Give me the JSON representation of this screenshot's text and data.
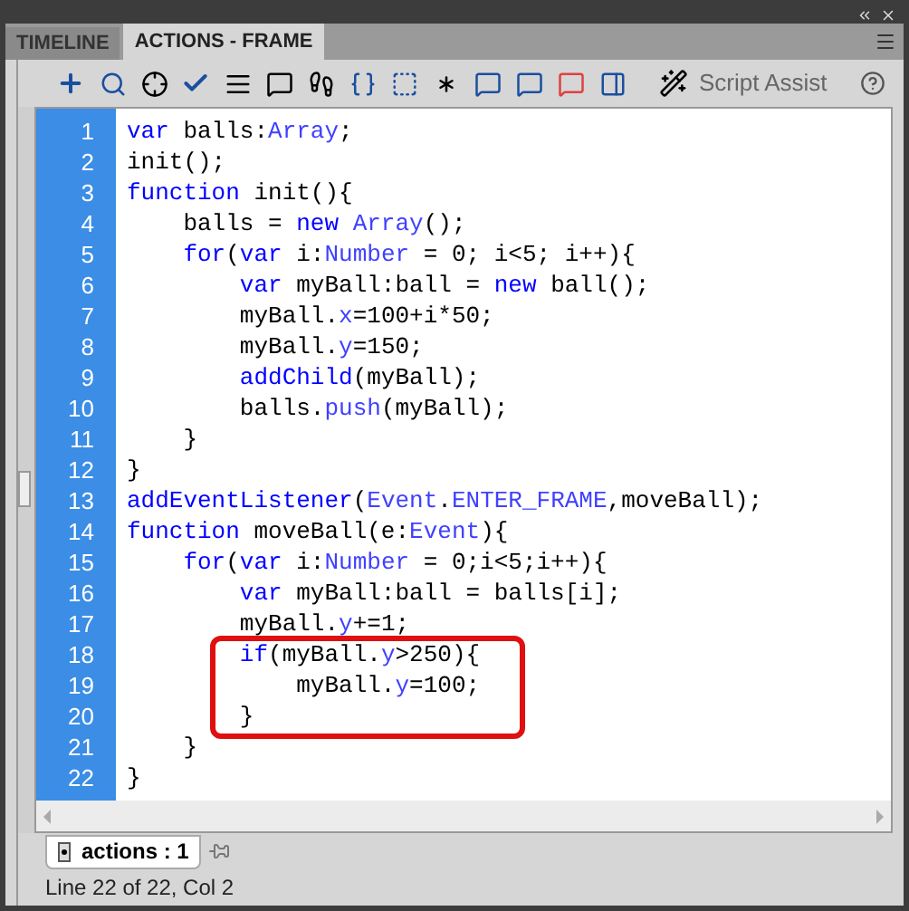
{
  "tabs": [
    {
      "label": "TIMELINE",
      "selected": false
    },
    {
      "label": "ACTIONS - FRAME",
      "selected": true
    }
  ],
  "toolbar": {
    "script_assist": "Script Assist"
  },
  "code": [
    {
      "kind": "line",
      "number": "1",
      "segments": [
        {
          "text": "var",
          "kind": "keyword"
        },
        {
          "text": " balls:",
          "kind": "plain"
        },
        {
          "text": "Array",
          "kind": "type"
        },
        {
          "text": ";",
          "kind": "plain"
        }
      ]
    },
    {
      "kind": "line",
      "number": "2",
      "segments": [
        {
          "text": "init();",
          "kind": "plain"
        }
      ]
    },
    {
      "kind": "line",
      "number": "3",
      "segments": [
        {
          "text": "function",
          "kind": "keyword"
        },
        {
          "text": " init(){",
          "kind": "plain"
        }
      ]
    },
    {
      "kind": "line",
      "number": "4",
      "segments": [
        {
          "text": "    balls = ",
          "kind": "plain"
        },
        {
          "text": "new",
          "kind": "keyword"
        },
        {
          "text": " Array",
          "kind": "type"
        },
        {
          "text": "();",
          "kind": "plain"
        }
      ]
    },
    {
      "kind": "line",
      "number": "5",
      "segments": [
        {
          "text": "    for",
          "kind": "keyword"
        },
        {
          "text": "(",
          "kind": "plain"
        },
        {
          "text": "var",
          "kind": "keyword"
        },
        {
          "text": " i:",
          "kind": "plain"
        },
        {
          "text": "Number",
          "kind": "type"
        },
        {
          "text": " = 0; i<5; i++){",
          "kind": "plain"
        }
      ]
    },
    {
      "kind": "line",
      "number": "6",
      "segments": [
        {
          "text": "        var",
          "kind": "keyword"
        },
        {
          "text": " myBall:ball = ",
          "kind": "plain"
        },
        {
          "text": "new",
          "kind": "keyword"
        },
        {
          "text": " ball();",
          "kind": "plain"
        }
      ]
    },
    {
      "kind": "line",
      "number": "7",
      "segments": [
        {
          "text": "        myBall.",
          "kind": "plain"
        },
        {
          "text": "x",
          "kind": "type"
        },
        {
          "text": "=100+i*50;",
          "kind": "plain"
        }
      ]
    },
    {
      "kind": "line",
      "number": "8",
      "segments": [
        {
          "text": "        myBall.",
          "kind": "plain"
        },
        {
          "text": "y",
          "kind": "type"
        },
        {
          "text": "=150;",
          "kind": "plain"
        }
      ]
    },
    {
      "kind": "line",
      "number": "9",
      "segments": [
        {
          "text": "        addChild",
          "kind": "keyword"
        },
        {
          "text": "(myBall);",
          "kind": "plain"
        }
      ]
    },
    {
      "kind": "line",
      "number": "10",
      "segments": [
        {
          "text": "        balls.",
          "kind": "plain"
        },
        {
          "text": "push",
          "kind": "type"
        },
        {
          "text": "(myBall);",
          "kind": "plain"
        }
      ]
    },
    {
      "kind": "line",
      "number": "11",
      "segments": [
        {
          "text": "    }",
          "kind": "plain"
        }
      ]
    },
    {
      "kind": "line",
      "number": "12",
      "segments": [
        {
          "text": "}",
          "kind": "plain"
        }
      ]
    },
    {
      "kind": "line",
      "number": "13",
      "segments": [
        {
          "text": "addEventListener",
          "kind": "keyword"
        },
        {
          "text": "(",
          "kind": "plain"
        },
        {
          "text": "Event",
          "kind": "type"
        },
        {
          "text": ".",
          "kind": "plain"
        },
        {
          "text": "ENTER_FRAME",
          "kind": "type"
        },
        {
          "text": ",moveBall);",
          "kind": "plain"
        }
      ]
    },
    {
      "kind": "line",
      "number": "14",
      "segments": [
        {
          "text": "function",
          "kind": "keyword"
        },
        {
          "text": " moveBall(e:",
          "kind": "plain"
        },
        {
          "text": "Event",
          "kind": "type"
        },
        {
          "text": "){",
          "kind": "plain"
        }
      ]
    },
    {
      "kind": "line",
      "number": "15",
      "segments": [
        {
          "text": "    for",
          "kind": "keyword"
        },
        {
          "text": "(",
          "kind": "plain"
        },
        {
          "text": "var",
          "kind": "keyword"
        },
        {
          "text": " i:",
          "kind": "plain"
        },
        {
          "text": "Number",
          "kind": "type"
        },
        {
          "text": " = 0;i<5;i++){",
          "kind": "plain"
        }
      ]
    },
    {
      "kind": "line",
      "number": "16",
      "segments": [
        {
          "text": "        var",
          "kind": "keyword"
        },
        {
          "text": " myBall:ball = balls[i];",
          "kind": "plain"
        }
      ]
    },
    {
      "kind": "line",
      "number": "17",
      "segments": [
        {
          "text": "        myBall.",
          "kind": "plain"
        },
        {
          "text": "y",
          "kind": "type"
        },
        {
          "text": "+=1;",
          "kind": "plain"
        }
      ]
    },
    {
      "kind": "boxed_group",
      "lines": [
        {
          "number": "18",
          "segments": [
            {
              "text": "        if",
              "kind": "keyword"
            },
            {
              "text": "(myBall.",
              "kind": "plain"
            },
            {
              "text": "y",
              "kind": "type"
            },
            {
              "text": ">250){",
              "kind": "plain"
            }
          ]
        },
        {
          "number": "19",
          "segments": [
            {
              "text": "            myBall.",
              "kind": "plain"
            },
            {
              "text": "y",
              "kind": "type"
            },
            {
              "text": "=100;",
              "kind": "plain"
            }
          ]
        },
        {
          "number": "20",
          "segments": [
            {
              "text": "        }",
              "kind": "plain"
            }
          ]
        }
      ]
    },
    {
      "kind": "line",
      "number": "21",
      "segments": [
        {
          "text": "    }",
          "kind": "plain"
        }
      ]
    },
    {
      "kind": "line",
      "number": "22",
      "segments": [
        {
          "text": "}",
          "kind": "plain"
        }
      ]
    }
  ],
  "script_tab": {
    "label": "actions : 1"
  },
  "status_bar": "Line 22 of 22, Col 2"
}
